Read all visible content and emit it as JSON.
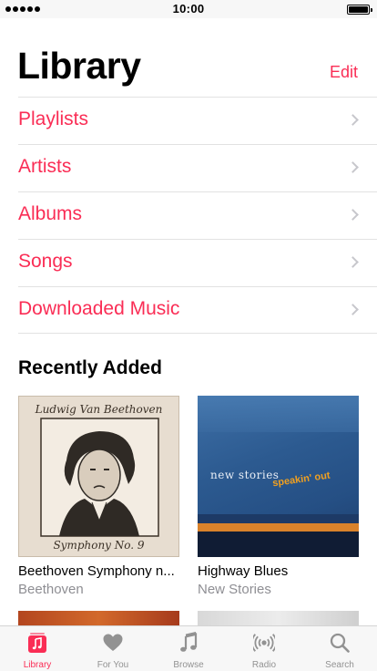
{
  "status_bar": {
    "time": "10:00"
  },
  "header": {
    "title": "Library",
    "edit_label": "Edit"
  },
  "menu": {
    "items": [
      {
        "label": "Playlists"
      },
      {
        "label": "Artists"
      },
      {
        "label": "Albums"
      },
      {
        "label": "Songs"
      },
      {
        "label": "Downloaded Music"
      }
    ]
  },
  "recently_added": {
    "title": "Recently Added",
    "albums": [
      {
        "title": "Beethoven Symphony n...",
        "artist": "Beethoven",
        "cover_top_text": "Ludwig Van Beethoven",
        "cover_bottom_text": "Symphony No. 9"
      },
      {
        "title": "Highway Blues",
        "artist": "New Stories",
        "cover_band_text": "new stories",
        "cover_title_text": "speakin' out"
      }
    ]
  },
  "tab_bar": {
    "tabs": [
      {
        "label": "Library",
        "icon": "library-icon",
        "active": true
      },
      {
        "label": "For You",
        "icon": "heart-icon",
        "active": false
      },
      {
        "label": "Browse",
        "icon": "music-note-icon",
        "active": false
      },
      {
        "label": "Radio",
        "icon": "radio-icon",
        "active": false
      },
      {
        "label": "Search",
        "icon": "search-icon",
        "active": false
      }
    ]
  },
  "colors": {
    "accent": "#fa2d55",
    "secondary_text": "#8e8e93",
    "separator": "#e2e2e2"
  }
}
